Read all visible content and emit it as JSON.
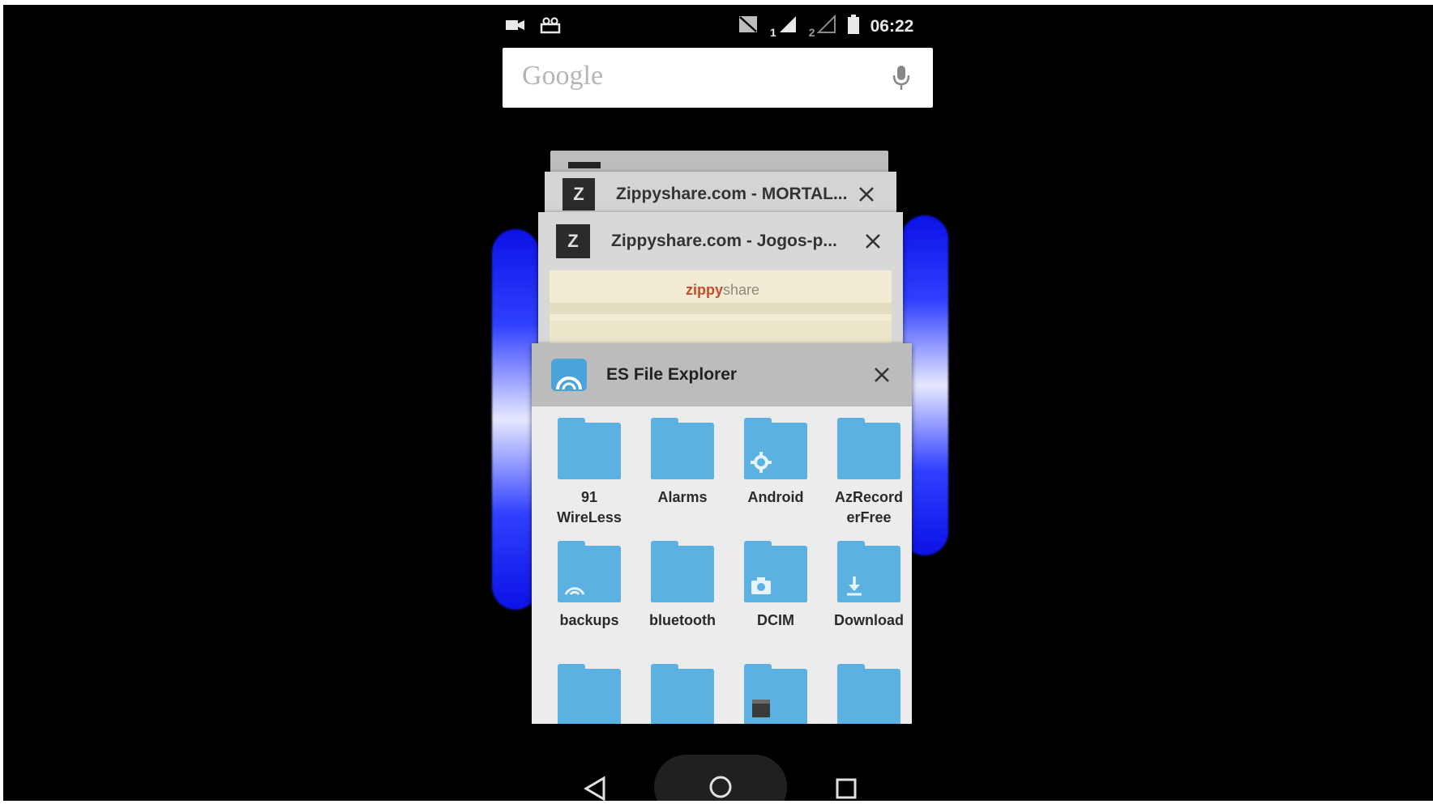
{
  "status_bar": {
    "left_icons": [
      "video-camera-icon",
      "notification-icon"
    ],
    "right_icons": [
      "no-sim-icon",
      "sim1-signal-icon",
      "sim2-signal-icon",
      "battery-icon"
    ],
    "sim1_label": "1",
    "sim2_label": "2",
    "time": "06:22"
  },
  "search": {
    "logo": "Google",
    "mic_icon": "microphone-icon"
  },
  "recents": {
    "cards": [
      {
        "title": "Zippyshare.com - MORTAL...",
        "icon_letter": "Z"
      },
      {
        "title": "Zippyshare.com - Jogos-p...",
        "icon_letter": "Z",
        "preview_brand_a": "zippy",
        "preview_brand_b": "share"
      },
      {
        "title": "ES File Explorer",
        "icon": "es-file-explorer-icon"
      }
    ],
    "folders": [
      {
        "label_line1": "91",
        "label_line2": "WireLess",
        "emblem": ""
      },
      {
        "label_line1": "Alarms",
        "label_line2": "",
        "emblem": ""
      },
      {
        "label_line1": "Android",
        "label_line2": "",
        "emblem": "gear-icon"
      },
      {
        "label_line1": "AzRecord",
        "label_line2": "erFree",
        "emblem": ""
      },
      {
        "label_line1": "backups",
        "label_line2": "",
        "emblem": "backup-icon"
      },
      {
        "label_line1": "bluetooth",
        "label_line2": "",
        "emblem": ""
      },
      {
        "label_line1": "DCIM",
        "label_line2": "",
        "emblem": "camera-icon"
      },
      {
        "label_line1": "Download",
        "label_line2": "",
        "emblem": "download-icon"
      },
      {
        "label_line1": "",
        "label_line2": "",
        "emblem": ""
      },
      {
        "label_line1": "",
        "label_line2": "",
        "emblem": ""
      },
      {
        "label_line1": "",
        "label_line2": "",
        "emblem": "movie-icon"
      },
      {
        "label_line1": "",
        "label_line2": "",
        "emblem": ""
      }
    ]
  },
  "navbar": {
    "back_icon": "back-triangle-icon",
    "home_icon": "home-circle-icon",
    "recents_icon": "recents-square-icon"
  },
  "colors": {
    "background": "#000000",
    "folder": "#5cb1e3",
    "glow": "#1a22ff"
  }
}
